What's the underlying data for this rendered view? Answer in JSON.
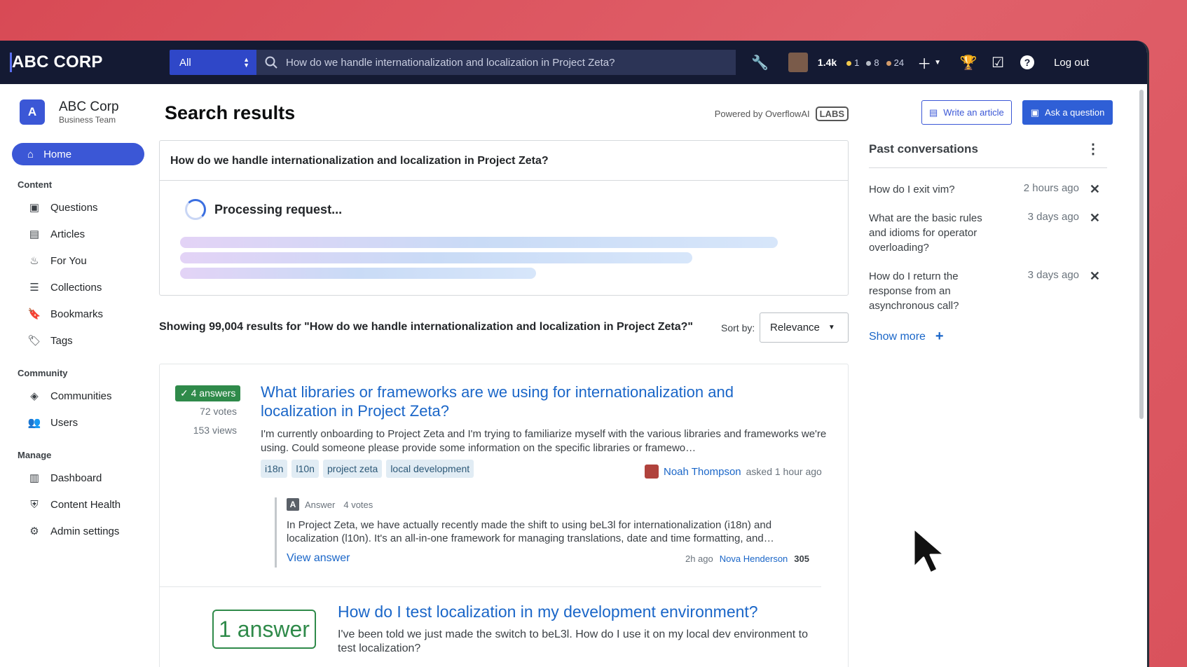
{
  "app": {
    "logo": "ABC CORP"
  },
  "topbar": {
    "scope": "All",
    "search_value": "How do we handle internationalization and localization in Project Zeta?",
    "reputation": "1.4k",
    "gold": "1",
    "silver": "8",
    "bronze": "24",
    "logout_label": "Log out",
    "colors": {
      "bg": "#141a33",
      "gold": "#f2c94c",
      "silver": "#b6bcc6",
      "bronze": "#d39b6a"
    },
    "icons": [
      "wrench-icon",
      "plus-icon",
      "trophy-icon",
      "review-icon",
      "help-icon"
    ]
  },
  "sidebar": {
    "org_initial": "A",
    "org_name": "ABC Corp",
    "org_sub": "Business Team",
    "home_label": "Home",
    "sections": {
      "content": "Content",
      "community": "Community",
      "manage": "Manage"
    },
    "items": {
      "questions": "Questions",
      "articles": "Articles",
      "for_you": "For You",
      "collections": "Collections",
      "bookmarks": "Bookmarks",
      "tags": "Tags",
      "communities": "Communities",
      "users": "Users",
      "dashboard": "Dashboard",
      "content_health": "Content Health",
      "admin_settings": "Admin settings"
    }
  },
  "main": {
    "title": "Search results",
    "powered_by": "Powered by OverflowAI",
    "labs": "LABS",
    "query": "How do we handle internationalization and localization in Project Zeta?",
    "processing": "Processing request...",
    "results_summary": "Showing 99,004 results for \"How do we handle internationalization and localization in Project Zeta?\"",
    "sort_label": "Sort by:",
    "sort_value": "Relevance",
    "results": [
      {
        "answers": "4 answers",
        "votes": "72 votes",
        "views": "153 views",
        "title": "What libraries or frameworks are we using for internationalization and localization in Project Zeta?",
        "excerpt": "I'm currently onboarding to Project Zeta and I'm trying to familiarize myself with the various libraries and frameworks we're using. Could someone please provide some information on the specific libraries or framewo…",
        "tags": [
          "i18n",
          "l10n",
          "project zeta",
          "local development"
        ],
        "author": "Noah Thompson",
        "asked": "asked 1 hour ago",
        "answer": {
          "label": "Answer",
          "votes": "4 votes",
          "text": "In Project Zeta, we have actually recently made the shift to using beL3l for internationalization (i18n) and localization (l10n). It's an all-in-one framework for managing translations, date and time formatting, and…",
          "view_label": "View answer",
          "time": "2h ago",
          "author": "Nova Henderson",
          "rep": "305"
        }
      },
      {
        "answers": "1 answer",
        "title": "How do I test localization in my development environment?",
        "excerpt": "I've been told we just made the switch to beL3l. How do I use it on my local dev environment to test localization?"
      }
    ]
  },
  "right": {
    "write_article": "Write an article",
    "ask_question": "Ask a question",
    "past_title": "Past conversations",
    "conversations": [
      {
        "text": "How do I exit vim?",
        "time": "2 hours ago"
      },
      {
        "text": "What are the basic rules and idioms for operator overloading?",
        "time": "3 days ago"
      },
      {
        "text": "How do I return the response from an asynchronous call?",
        "time": "3 days ago"
      }
    ],
    "show_more": "Show more"
  }
}
